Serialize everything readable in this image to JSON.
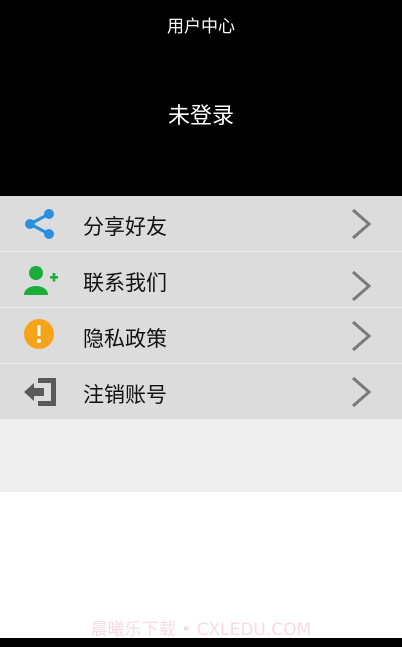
{
  "header": {
    "title": "用户中心",
    "status": "未登录"
  },
  "menu": {
    "items": [
      {
        "label": "分享好友",
        "icon": "share-icon",
        "color": "#2b8fe0"
      },
      {
        "label": "联系我们",
        "icon": "add-contact-icon",
        "color": "#1aad3a"
      },
      {
        "label": "隐私政策",
        "icon": "warning-icon",
        "color": "#f5a318"
      },
      {
        "label": "注销账号",
        "icon": "logout-icon",
        "color": "#5a5a5a"
      }
    ]
  },
  "watermark": "晨曦乐下载 • CXLEDU.COM"
}
